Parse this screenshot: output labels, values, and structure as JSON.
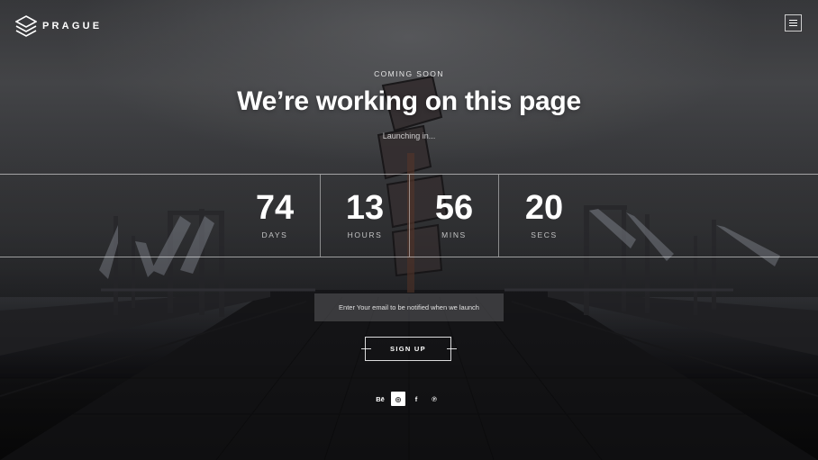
{
  "brand": {
    "name": "PRAGUE",
    "logo_icon": "stacked-diamond-logo"
  },
  "header": {
    "menu_icon": "hamburger-menu-icon"
  },
  "hero": {
    "eyebrow": "COMING SOON",
    "title": "We’re working on this page",
    "subtitle": "Launching in..."
  },
  "countdown": [
    {
      "value": "74",
      "label": "DAYS"
    },
    {
      "value": "13",
      "label": "HOURS"
    },
    {
      "value": "56",
      "label": "MINS"
    },
    {
      "value": "20",
      "label": "SECS"
    }
  ],
  "form": {
    "email_placeholder": "Enter Your email to be notified when we launch",
    "email_value": "",
    "signup_label": "SIGN UP"
  },
  "social": [
    {
      "label": "Bē",
      "icon": "behance-icon",
      "active": false
    },
    {
      "label": "◎",
      "icon": "dribbble-icon",
      "active": true
    },
    {
      "label": "f",
      "icon": "facebook-icon",
      "active": false
    },
    {
      "label": "℗",
      "icon": "pinterest-icon",
      "active": false
    }
  ],
  "colors": {
    "accent": "#ffffff",
    "overlay": "#2f3033"
  }
}
